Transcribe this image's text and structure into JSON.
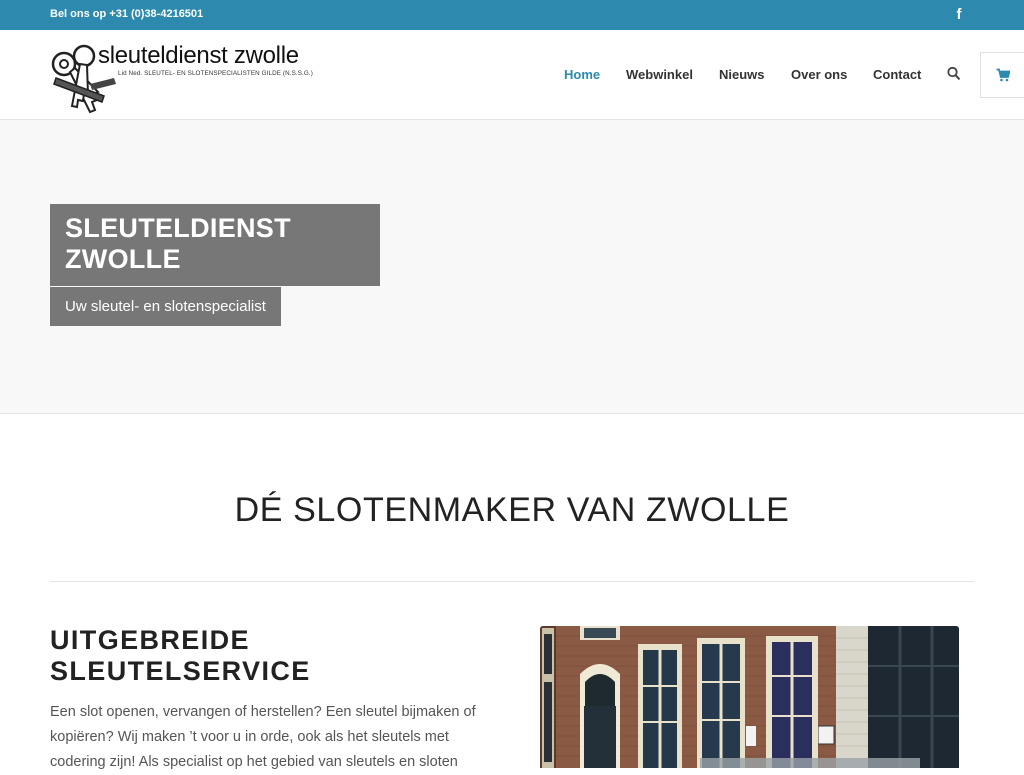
{
  "topbar": {
    "phone": "Bel ons op +31 (0)38-4216501",
    "social_icon": "facebook-icon"
  },
  "logo": {
    "title": "sleuteldienst zwolle",
    "subtitle": "Lid Ned. SLEUTEL- EN SLOTENSPECIALISTEN GILDE (N.S.S.G.)",
    "icon": "keys-icon"
  },
  "nav": {
    "items": [
      {
        "label": "Home",
        "active": true
      },
      {
        "label": "Webwinkel",
        "active": false
      },
      {
        "label": "Nieuws",
        "active": false
      },
      {
        "label": "Over ons",
        "active": false
      },
      {
        "label": "Contact",
        "active": false
      }
    ],
    "search_icon": "search-icon",
    "cart_icon": "cart-icon"
  },
  "hero": {
    "title_line1": "SLEUTELDIENST",
    "title_line2": "ZWOLLE",
    "subtitle": "Uw sleutel- en slotenspecialist"
  },
  "section": {
    "heading": "DÉ SLOTENMAKER VAN ZWOLLE"
  },
  "service": {
    "title_line1": "UITGEBREIDE",
    "title_line2": "SLEUTELSERVICE",
    "text": "Een slot openen, vervangen of herstellen? Een sleutel bijmaken of  kopiëren? Wij maken ’t voor u in orde, ook als het sleutels met codering zijn! Als specialist op het gebied van sleutels en sloten"
  },
  "colors": {
    "brand": "#2d8aae",
    "hero_box": "#777777",
    "hero_bg": "#f8f8f8"
  }
}
